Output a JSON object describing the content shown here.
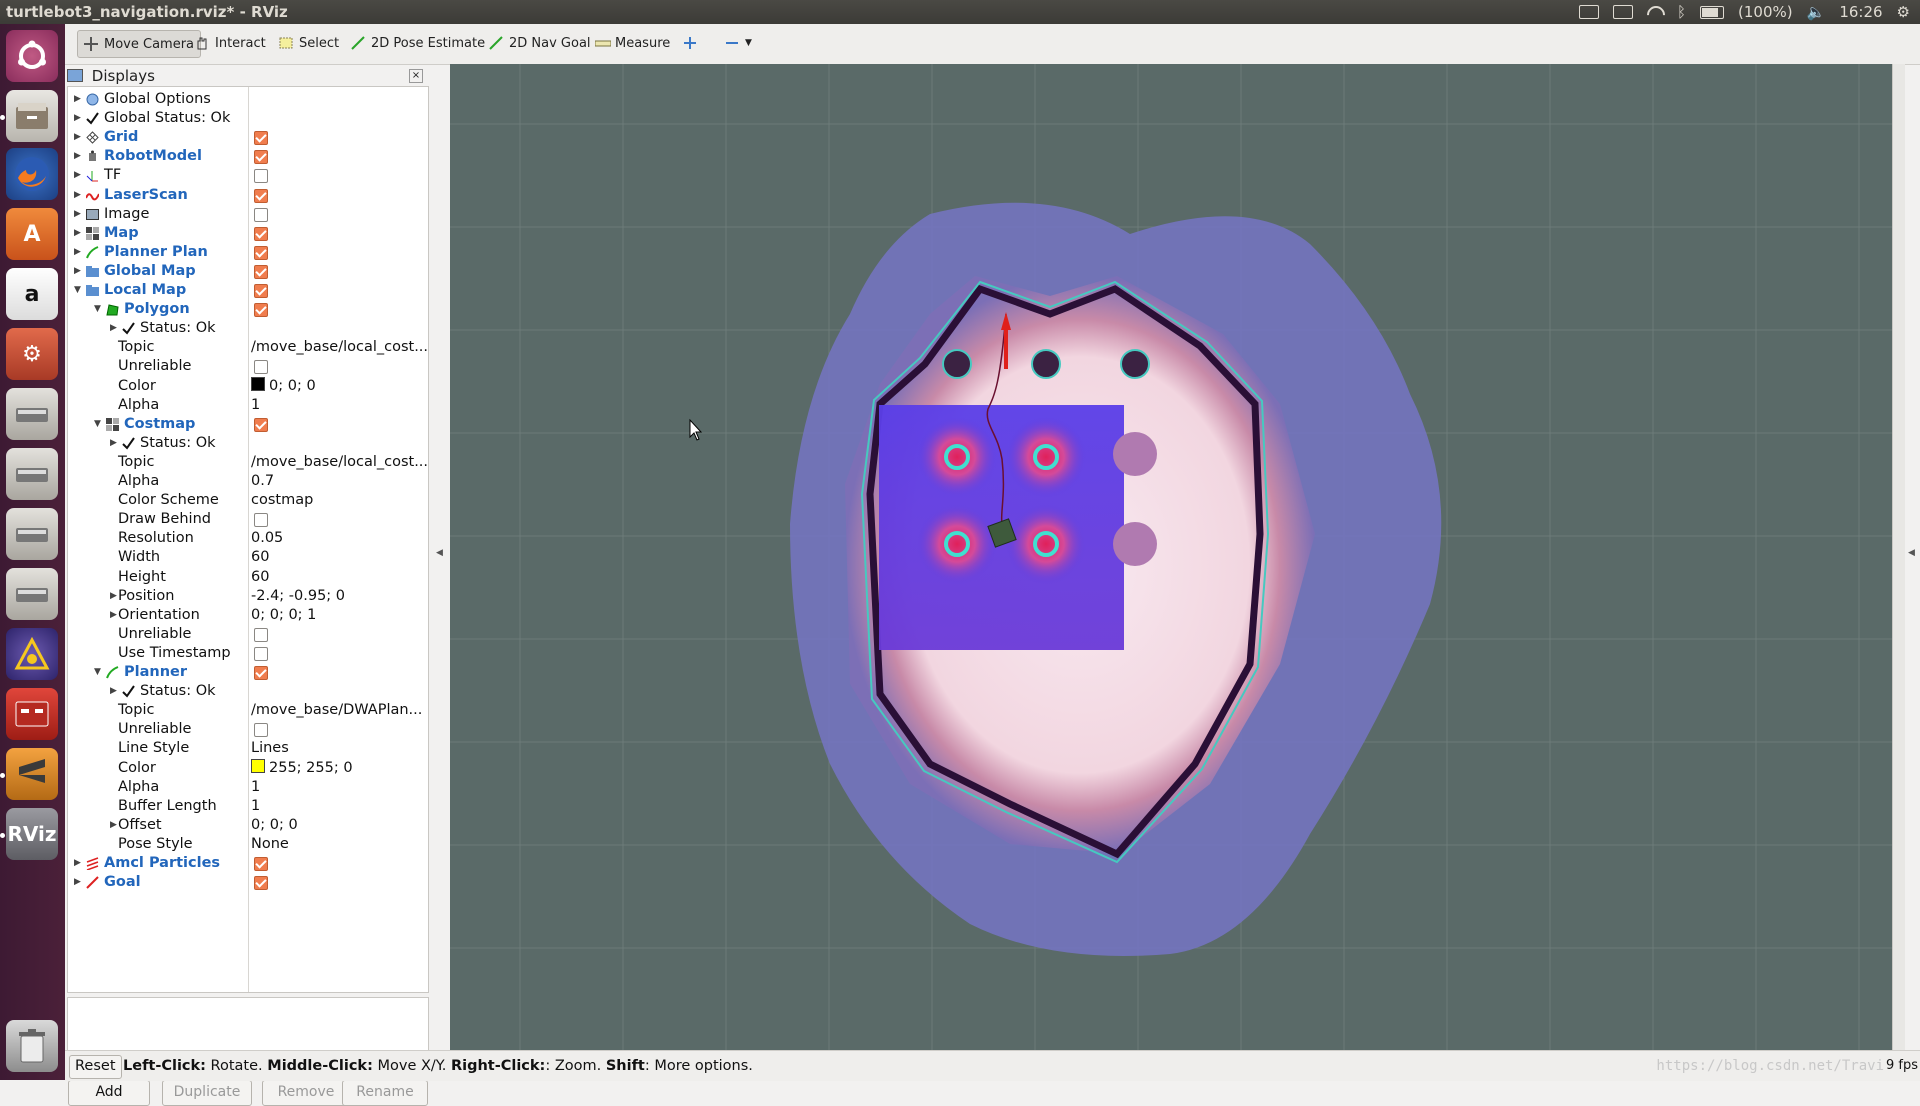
{
  "window": {
    "title": "turtlebot3_navigation.rviz* - RViz"
  },
  "system_tray": {
    "battery": "(100%)",
    "time": "16:26"
  },
  "toolbar": {
    "tools": [
      {
        "label": "Move Camera",
        "icon": "move-camera-icon",
        "active": true
      },
      {
        "label": "Interact",
        "icon": "hand-icon"
      },
      {
        "label": "Select",
        "icon": "select-box-icon"
      },
      {
        "label": "2D Pose Estimate",
        "icon": "green-arrow-icon"
      },
      {
        "label": "2D Nav Goal",
        "icon": "green-arrow-icon"
      },
      {
        "label": "Measure",
        "icon": "ruler-icon"
      }
    ]
  },
  "displays_panel": {
    "title": "Displays",
    "rows": [
      {
        "label": "Global Options",
        "indent": 0,
        "arrow": "▶",
        "icon": "globe-icon"
      },
      {
        "label": "Global Status: Ok",
        "indent": 0,
        "arrow": "▶",
        "icon": "check-icon"
      },
      {
        "label": "Grid",
        "indent": 0,
        "arrow": "▶",
        "icon": "grid-icon",
        "blue": true,
        "check": true
      },
      {
        "label": "RobotModel",
        "indent": 0,
        "arrow": "▶",
        "icon": "robot-icon",
        "blue": true,
        "check": true
      },
      {
        "label": "TF",
        "indent": 0,
        "arrow": "▶",
        "icon": "axes-icon",
        "check": false
      },
      {
        "label": "LaserScan",
        "indent": 0,
        "arrow": "▶",
        "icon": "laser-icon",
        "blue": true,
        "check": true
      },
      {
        "label": "Image",
        "indent": 0,
        "arrow": "▶",
        "icon": "image-icon",
        "check": false
      },
      {
        "label": "Map",
        "indent": 0,
        "arrow": "▶",
        "icon": "map-icon",
        "blue": true,
        "check": true
      },
      {
        "label": "Planner Plan",
        "indent": 0,
        "arrow": "▶",
        "icon": "path-icon",
        "blue": true,
        "check": true
      },
      {
        "label": "Global Map",
        "indent": 0,
        "arrow": "▶",
        "icon": "folder-icon",
        "blue": true,
        "check": true
      },
      {
        "label": "Local Map",
        "indent": 0,
        "arrow": "▼",
        "icon": "folder-icon",
        "blue": true,
        "check": true
      },
      {
        "label": "Polygon",
        "indent": 1,
        "arrow": "▼",
        "icon": "polygon-icon",
        "blue": true,
        "check": true
      },
      {
        "label": "Status: Ok",
        "indent": 2,
        "arrow": "▶",
        "icon": "check-icon"
      },
      {
        "label": "Topic",
        "indent": 2,
        "value": "/move_base/local_cost..."
      },
      {
        "label": "Unreliable",
        "indent": 2,
        "check": false
      },
      {
        "label": "Color",
        "indent": 2,
        "value": "0; 0; 0",
        "swatch": "#000000"
      },
      {
        "label": "Alpha",
        "indent": 2,
        "value": "1"
      },
      {
        "label": "Costmap",
        "indent": 1,
        "arrow": "▼",
        "icon": "map-icon",
        "blue": true,
        "check": true
      },
      {
        "label": "Status: Ok",
        "indent": 2,
        "arrow": "▶",
        "icon": "check-icon"
      },
      {
        "label": "Topic",
        "indent": 2,
        "value": "/move_base/local_cost..."
      },
      {
        "label": "Alpha",
        "indent": 2,
        "value": "0.7"
      },
      {
        "label": "Color Scheme",
        "indent": 2,
        "value": "costmap"
      },
      {
        "label": "Draw Behind",
        "indent": 2,
        "check": false
      },
      {
        "label": "Resolution",
        "indent": 2,
        "value": "0.05"
      },
      {
        "label": "Width",
        "indent": 2,
        "value": "60"
      },
      {
        "label": "Height",
        "indent": 2,
        "value": "60"
      },
      {
        "label": "Position",
        "indent": 2,
        "arrow": "▶",
        "value": "-2.4; -0.95; 0"
      },
      {
        "label": "Orientation",
        "indent": 2,
        "arrow": "▶",
        "value": "0; 0; 0; 1"
      },
      {
        "label": "Unreliable",
        "indent": 2,
        "check": false
      },
      {
        "label": "Use Timestamp",
        "indent": 2,
        "check": false
      },
      {
        "label": "Planner",
        "indent": 1,
        "arrow": "▼",
        "icon": "path-icon",
        "blue": true,
        "check": true
      },
      {
        "label": "Status: Ok",
        "indent": 2,
        "arrow": "▶",
        "icon": "check-icon"
      },
      {
        "label": "Topic",
        "indent": 2,
        "value": "/move_base/DWAPlan..."
      },
      {
        "label": "Unreliable",
        "indent": 2,
        "check": false
      },
      {
        "label": "Line Style",
        "indent": 2,
        "value": "Lines"
      },
      {
        "label": "Color",
        "indent": 2,
        "value": "255; 255; 0",
        "swatch": "#ffff00"
      },
      {
        "label": "Alpha",
        "indent": 2,
        "value": "1"
      },
      {
        "label": "Buffer Length",
        "indent": 2,
        "value": "1"
      },
      {
        "label": "Offset",
        "indent": 2,
        "arrow": "▶",
        "value": "0; 0; 0"
      },
      {
        "label": "Pose Style",
        "indent": 2,
        "value": "None"
      },
      {
        "label": "Amcl Particles",
        "indent": 0,
        "arrow": "▶",
        "icon": "particles-icon",
        "blue": true,
        "check": true
      },
      {
        "label": "Goal",
        "indent": 0,
        "arrow": "▶",
        "icon": "goal-arrow-icon",
        "blue": true,
        "check": true
      }
    ],
    "buttons": {
      "add": "Add",
      "duplicate": "Duplicate",
      "remove": "Remove",
      "rename": "Rename"
    }
  },
  "statusbar": {
    "reset": "Reset",
    "hint_parts": [
      {
        "text": "Left-Click:",
        "bold": true
      },
      {
        "text": " Rotate. ",
        "bold": false
      },
      {
        "text": "Middle-Click:",
        "bold": true
      },
      {
        "text": " Move X/Y. ",
        "bold": false
      },
      {
        "text": "Right-Click:",
        "bold": true
      },
      {
        "text": ": Zoom. ",
        "bold": false
      },
      {
        "text": "Shift",
        "bold": true
      },
      {
        "text": ": More options.",
        "bold": false
      }
    ],
    "watermark": "https://blog.csdn.net/Travi",
    "fps": "9 fps"
  },
  "colors": {
    "viewport_bg": "#5a6a68",
    "checkbox_on": "#f07d4e",
    "blue_label": "#2266bb",
    "launcher_bg": "#4b2039"
  }
}
